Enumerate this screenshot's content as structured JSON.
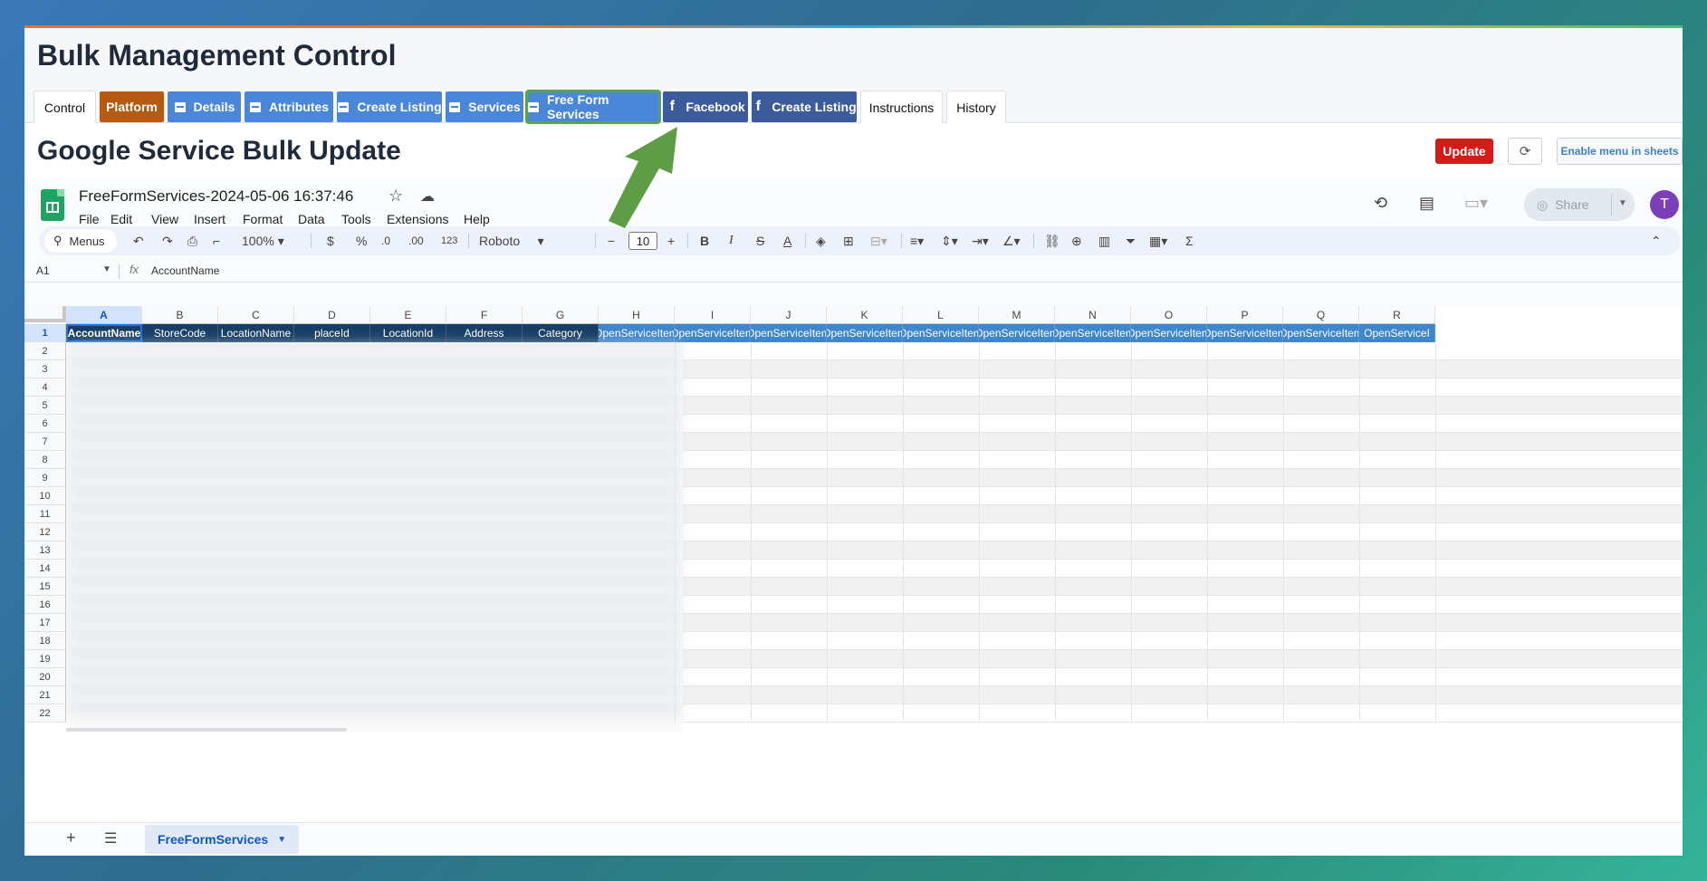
{
  "app": {
    "title": "Bulk Management Control"
  },
  "tabs": [
    {
      "label": "Control",
      "style": "plain"
    },
    {
      "label": "Platform",
      "style": "orange"
    },
    {
      "label": "Details",
      "style": "blue"
    },
    {
      "label": "Attributes",
      "style": "blue"
    },
    {
      "label": "Create Listing",
      "style": "blue"
    },
    {
      "label": "Services",
      "style": "blue"
    },
    {
      "label": "Free Form Services",
      "style": "blue",
      "selected": true
    },
    {
      "label": "Facebook",
      "style": "fb"
    },
    {
      "label": "Create Listing",
      "style": "fb"
    },
    {
      "label": "Instructions",
      "style": "plain"
    },
    {
      "label": "History",
      "style": "plain"
    }
  ],
  "section": {
    "title": "Google Service Bulk Update"
  },
  "actions": {
    "update": "Update",
    "enable_menu": "Enable menu in sheets"
  },
  "sheets": {
    "doc_name": "FreeFormServices-2024-05-06 16:37:46",
    "menu": [
      "File",
      "Edit",
      "View",
      "Insert",
      "Format",
      "Data",
      "Tools",
      "Extensions",
      "Help"
    ],
    "share": "Share",
    "avatar": "T",
    "toolbar": {
      "menus": "Menus",
      "zoom": "100%",
      "currency": "$",
      "percent": "%",
      "dec_dec": ".0",
      "dec_inc": ".00",
      "number": "123",
      "font": "Roboto",
      "font_size": "10",
      "bold": "B",
      "italic": "I",
      "strike": "S",
      "textcolor": "A",
      "sum": "Σ"
    },
    "name_box": "A1",
    "fx": "fx",
    "formula_value": "AccountName",
    "columns": [
      "A",
      "B",
      "C",
      "D",
      "E",
      "F",
      "G",
      "H",
      "I",
      "J",
      "K",
      "L",
      "M",
      "N",
      "O",
      "P",
      "Q",
      "R"
    ],
    "header_row": [
      "AccountName",
      "StoreCode",
      "LocationName",
      "placeId",
      "LocationId",
      "Address",
      "Category",
      "OpenServiceItem",
      "OpenServiceItem",
      "OpenServiceItem",
      "OpenServiceItem",
      "OpenServiceItem",
      "OpenServiceItem",
      "OpenServiceItem",
      "OpenServiceItem",
      "OpenServiceItem",
      "OpenServiceItem",
      "OpenServiceI"
    ],
    "rows": [
      "1",
      "2",
      "3",
      "4",
      "5",
      "6",
      "7",
      "8",
      "9",
      "10",
      "11",
      "12",
      "13",
      "14",
      "15",
      "16",
      "17",
      "18",
      "19",
      "20",
      "21",
      "22"
    ],
    "sheet_tab": "FreeFormServices",
    "colors": {
      "header_dark": "#173f66",
      "header_light": "#3f86cc"
    }
  }
}
